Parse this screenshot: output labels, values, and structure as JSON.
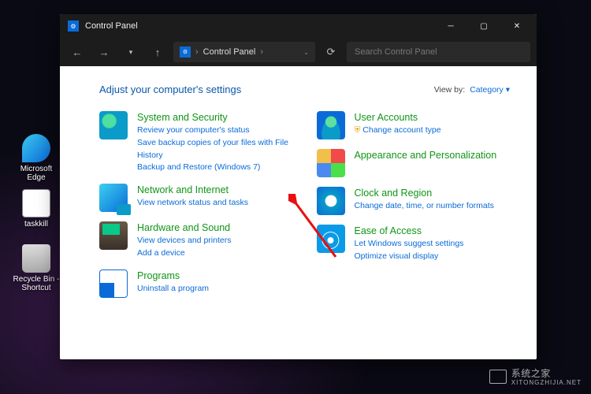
{
  "desktop": {
    "icons": [
      {
        "label": "Microsoft Edge"
      },
      {
        "label": "taskkill"
      },
      {
        "label": "Recycle Bin - Shortcut"
      }
    ]
  },
  "window": {
    "title": "Control Panel",
    "breadcrumb": "Control Panel",
    "search_placeholder": "Search Control Panel"
  },
  "header": {
    "title": "Adjust your computer's settings",
    "viewby_label": "View by:",
    "viewby_value": "Category"
  },
  "left": [
    {
      "title": "System and Security",
      "subs": [
        "Review your computer's status",
        "Save backup copies of your files with File History",
        "Backup and Restore (Windows 7)"
      ]
    },
    {
      "title": "Network and Internet",
      "subs": [
        "View network status and tasks"
      ]
    },
    {
      "title": "Hardware and Sound",
      "subs": [
        "View devices and printers",
        "Add a device"
      ]
    },
    {
      "title": "Programs",
      "subs": [
        "Uninstall a program"
      ]
    }
  ],
  "right": [
    {
      "title": "User Accounts",
      "subs": [
        "Change account type"
      ],
      "prefix_icon": true
    },
    {
      "title": "Appearance and Personalization",
      "subs": []
    },
    {
      "title": "Clock and Region",
      "subs": [
        "Change date, time, or number formats"
      ]
    },
    {
      "title": "Ease of Access",
      "subs": [
        "Let Windows suggest settings",
        "Optimize visual display"
      ]
    }
  ],
  "watermark": {
    "main": "系统之家",
    "sub": "XITONGZHIJIA.NET"
  }
}
